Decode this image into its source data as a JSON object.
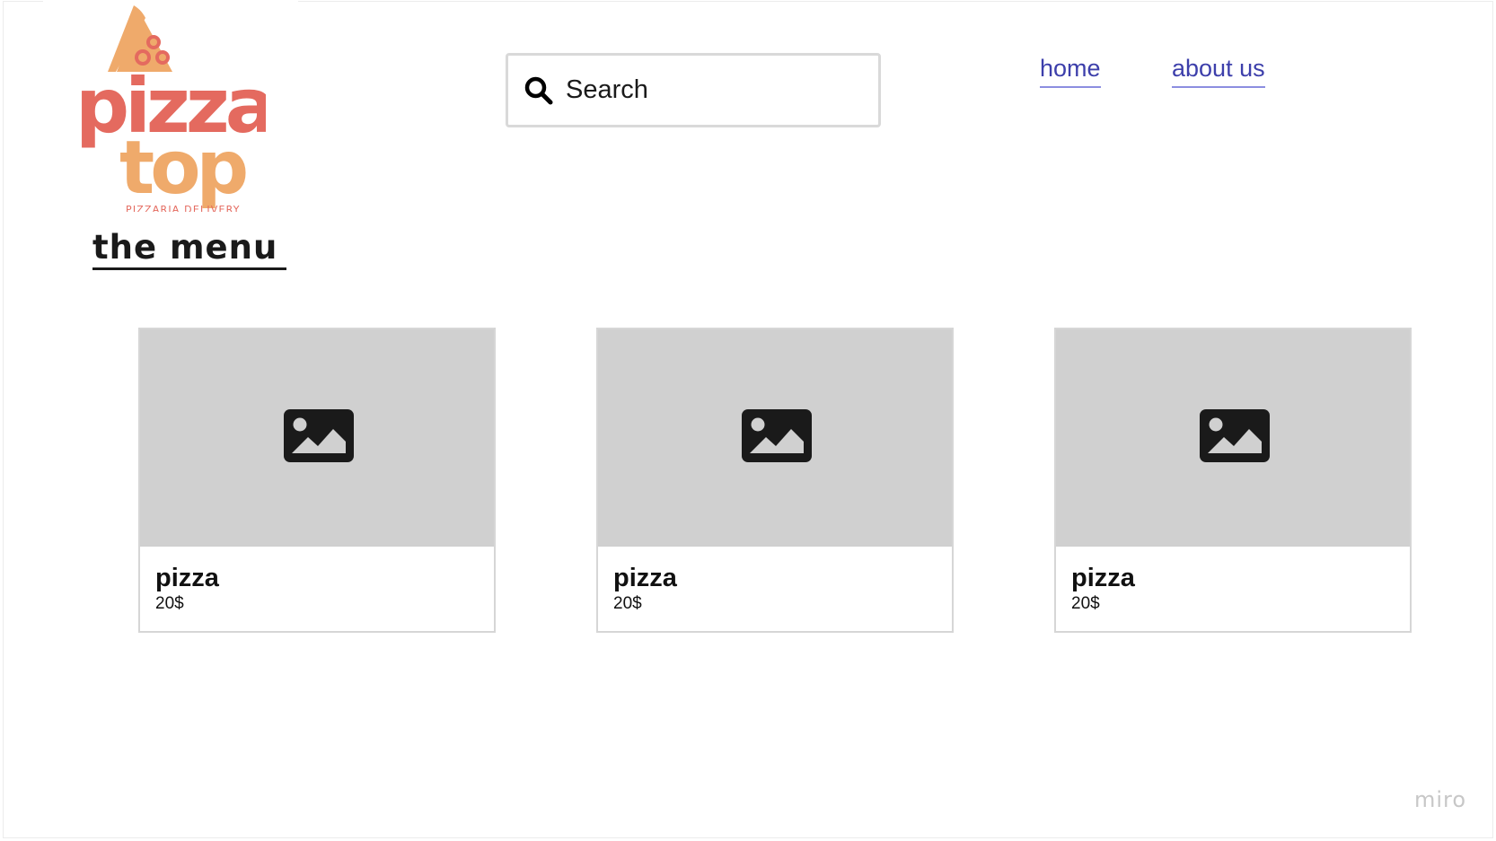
{
  "brand": {
    "logo_word_1": "pizza",
    "logo_word_2": "top",
    "logo_tagline": "PIZZARIA DELIVERY",
    "colors": {
      "primary": "#e46a5f",
      "secondary": "#efaa6b"
    }
  },
  "search": {
    "placeholder": "Search",
    "value": "",
    "icon": "search-icon"
  },
  "nav": {
    "items": [
      {
        "label": "home"
      },
      {
        "label": "about us"
      }
    ],
    "link_color": "#3d3fab"
  },
  "menu": {
    "title": "the menu",
    "items": [
      {
        "name": "pizza",
        "price": "20$",
        "image_icon": "image-placeholder-icon"
      },
      {
        "name": "pizza",
        "price": "20$",
        "image_icon": "image-placeholder-icon"
      },
      {
        "name": "pizza",
        "price": "20$",
        "image_icon": "image-placeholder-icon"
      }
    ]
  },
  "watermark": "miro"
}
